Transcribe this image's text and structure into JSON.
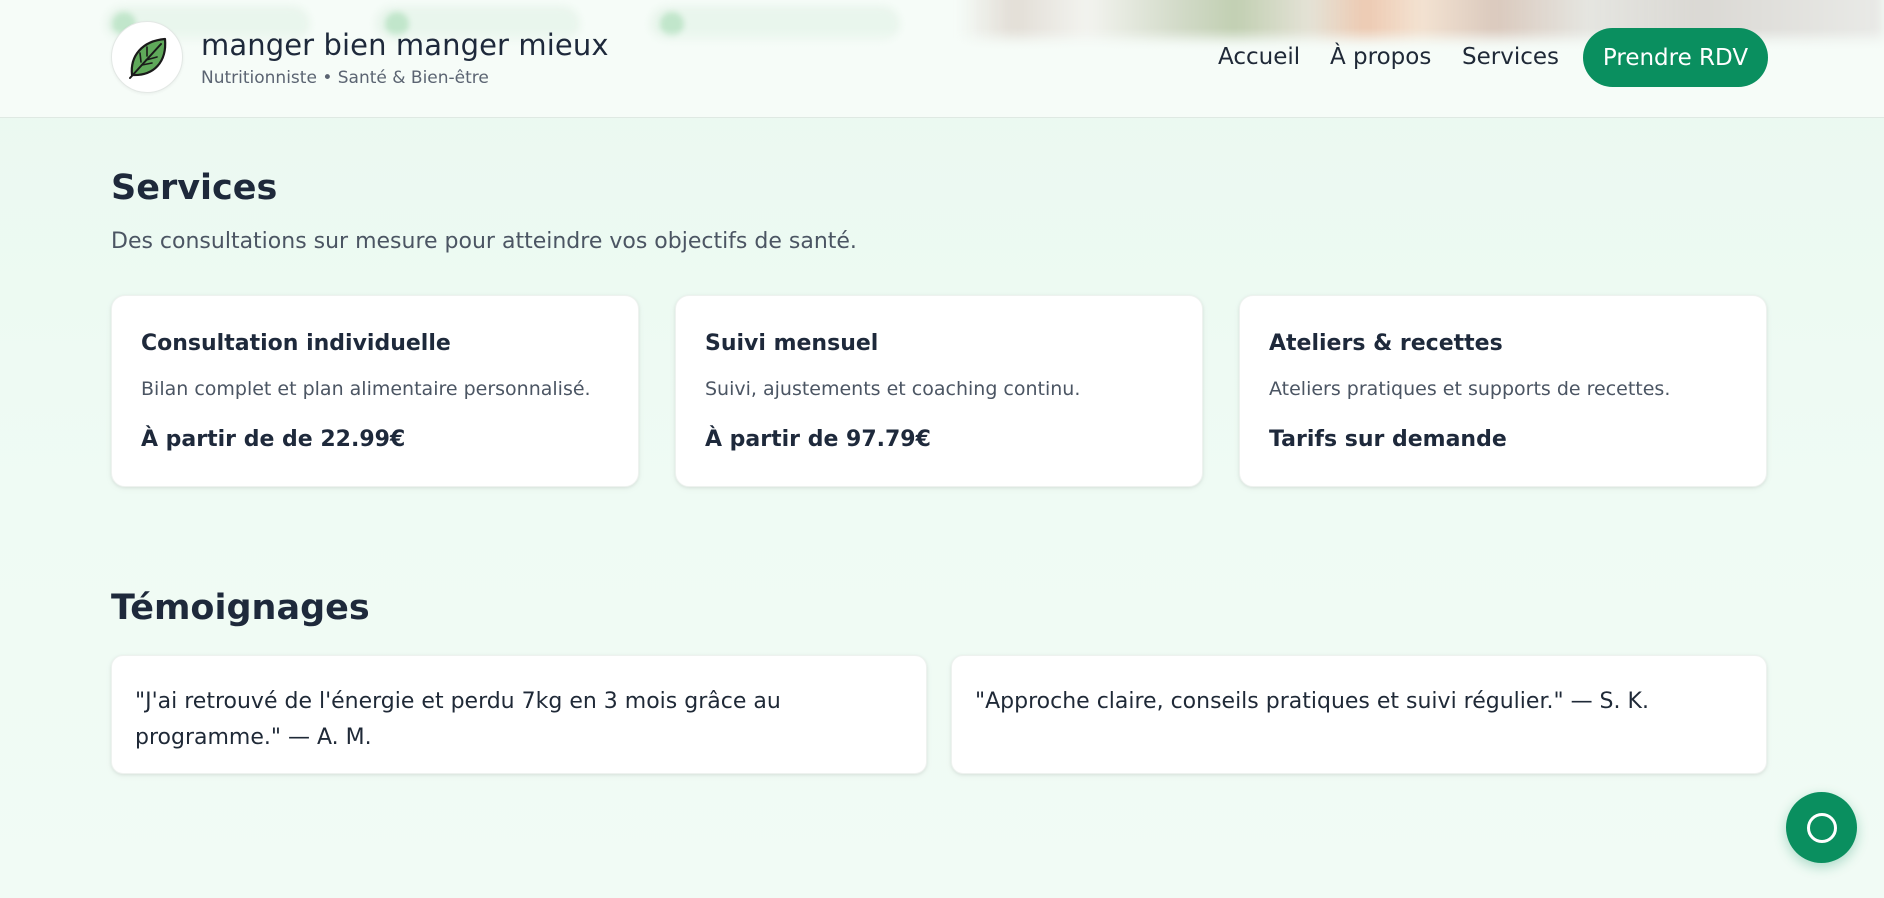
{
  "header": {
    "brand_title": "manger bien manger mieux",
    "brand_subtitle": "Nutritionniste • Santé & Bien-être",
    "logo_icon": "leaf-icon",
    "nav": [
      {
        "label": "Accueil"
      },
      {
        "label": "À propos"
      },
      {
        "label": "Services"
      }
    ],
    "cta_label": "Prendre RDV"
  },
  "services": {
    "title": "Services",
    "lead": "Des consultations sur mesure pour atteindre vos objectifs de santé.",
    "cards": [
      {
        "title": "Consultation individuelle",
        "description": "Bilan complet et plan alimentaire personnalisé.",
        "price": "À partir de de 22.99€"
      },
      {
        "title": "Suivi mensuel",
        "description": "Suivi, ajustements et coaching continu.",
        "price": "À partir de 97.79€"
      },
      {
        "title": "Ateliers & recettes",
        "description": "Ateliers pratiques et supports de recettes.",
        "price": "Tarifs sur demande"
      }
    ]
  },
  "testimonials": {
    "title": "Témoignages",
    "items": [
      {
        "quote": "\"J'ai retrouvé de l'énergie et perdu 7kg en 3 mois grâce au programme.\" — A. M."
      },
      {
        "quote": "\"Approche claire, conseils pratiques et suivi régulier.\" — S. K."
      }
    ]
  },
  "chat_button": {
    "icon": "chat-circle-icon"
  },
  "colors": {
    "accent": "#0a8f5f",
    "page_background": "#eaf8f0",
    "card_background": "#ffffff",
    "heading_text": "#1e293b",
    "muted_text": "#4b5563"
  }
}
